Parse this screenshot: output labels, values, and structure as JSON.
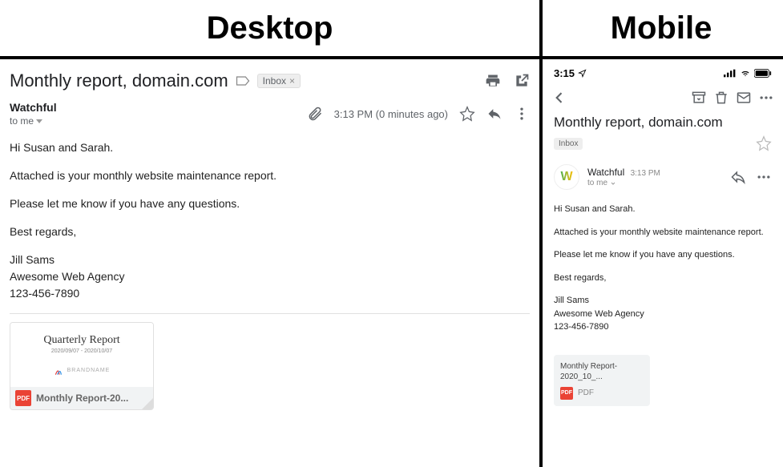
{
  "labels": {
    "desktop": "Desktop",
    "mobile": "Mobile"
  },
  "desktop": {
    "subject": "Monthly report, domain.com",
    "inbox_label": "Inbox",
    "sender": "Watchful",
    "recipient": "to me",
    "timestamp": "3:13 PM (0 minutes ago)",
    "body": {
      "greeting": "Hi Susan and Sarah.",
      "line1": "Attached is your monthly website maintenance report.",
      "line2": "Please let me know if you have any questions.",
      "closing": "Best regards,",
      "sig_name": "Jill Sams",
      "sig_company": "Awesome Web Agency",
      "sig_phone": "123-456-7890"
    },
    "attachment": {
      "preview_title": "Quarterly Report",
      "preview_dates": "2020/09/07 - 2020/10/07",
      "preview_brand": "BRANDNAME",
      "filename": "Monthly Report-20...",
      "badge": "PDF"
    }
  },
  "mobile": {
    "status_time": "3:15",
    "subject": "Monthly report, domain.com",
    "inbox_label": "Inbox",
    "sender": "Watchful",
    "sender_initial": "W",
    "timestamp": "3:13 PM",
    "recipient": "to me",
    "body": {
      "greeting": "Hi Susan and Sarah.",
      "line1": "Attached is your monthly website maintenance report.",
      "line2": "Please let me know if you have any questions.",
      "closing": "Best regards,",
      "sig_name": "Jill Sams",
      "sig_company": "Awesome Web Agency",
      "sig_phone": "123-456-7890"
    },
    "attachment": {
      "filename": "Monthly Report-2020_10_...",
      "type": "PDF",
      "badge": "PDF"
    }
  }
}
